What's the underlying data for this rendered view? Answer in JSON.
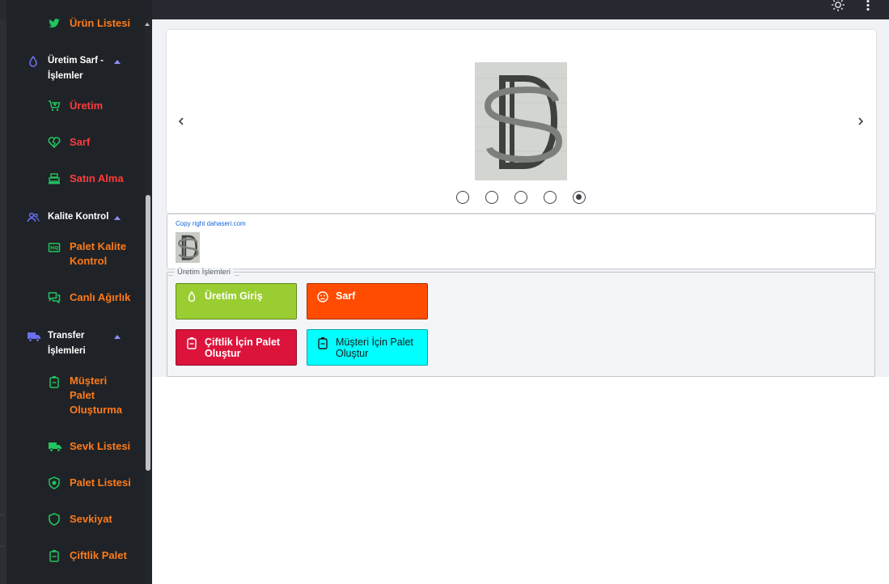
{
  "topbar": {
    "menu_icon": "hamburger-menu-icon",
    "theme_icon": "sun-icon",
    "more_icon": "more-vertical-icon",
    "background": "#262a30"
  },
  "sidebar": {
    "background": "#1f2327",
    "items": [
      {
        "label": "Ürün Listesi",
        "icon": "twitter-bird-icon",
        "type": "item"
      },
      {
        "label": "Üretim Sarf - İşlemler",
        "icon": "water-drop-icon",
        "type": "group",
        "expanded": true
      },
      {
        "label": "Üretim",
        "icon": "cart-plus-icon",
        "type": "item"
      },
      {
        "label": "Sarf",
        "icon": "heart-broken-icon",
        "type": "item"
      },
      {
        "label": "Satın Alma",
        "icon": "cash-register-icon",
        "type": "item"
      },
      {
        "label": "Kalite Kontrol",
        "icon": "users-icon",
        "type": "group",
        "expanded": true
      },
      {
        "label": "Palet Kalite Kontrol",
        "icon": "hq-badge-icon",
        "type": "item"
      },
      {
        "label": "Canlı Ağırlık",
        "icon": "chat-bubbles-icon",
        "type": "item"
      },
      {
        "label": "Transfer İşlemleri",
        "icon": "truck-icon",
        "type": "group",
        "expanded": true
      },
      {
        "label": "Müşteri Palet Oluşturma",
        "icon": "battery-icon",
        "type": "item"
      },
      {
        "label": "Sevk Listesi",
        "icon": "truck-icon",
        "type": "item"
      },
      {
        "label": "Palet Listesi",
        "icon": "shield-plus-icon",
        "type": "item"
      },
      {
        "label": "Sevkiyat",
        "icon": "shield-icon",
        "type": "item"
      },
      {
        "label": "Çiftlik Palet",
        "icon": "battery-icon",
        "type": "item"
      }
    ]
  },
  "carousel": {
    "prev_icon": "chevron-left-icon",
    "next_icon": "chevron-right-icon",
    "slide_count": 5,
    "active_slide": 5
  },
  "copyright": {
    "text": "Copy right dahaseri.com"
  },
  "production": {
    "legend": "Üretim İşlemleri",
    "buttons": [
      {
        "label": "Üretim Giriş",
        "icon": "water-drop-icon",
        "bg": "#9acd32",
        "fg": "#ffffff"
      },
      {
        "label": "Sarf",
        "icon": "sad-face-icon",
        "bg": "#ff4c00",
        "fg": "#ffffff"
      },
      {
        "label": "Çiftlik İçin Palet Oluştur",
        "icon": "battery-icon",
        "bg": "#dc143c",
        "fg": "#ffffff"
      },
      {
        "label": "Müşteri İçin Palet Oluştur",
        "icon": "battery-icon",
        "bg": "#00ffff",
        "fg": "#1a1a1a"
      }
    ]
  },
  "colors": {
    "nav_item_text": "#ff7a1a",
    "nav_item_text_red": "#ff3b3b",
    "nav_icon": "#22c55e",
    "group_icon": "#6b6ff0",
    "link": "#1463d8"
  }
}
